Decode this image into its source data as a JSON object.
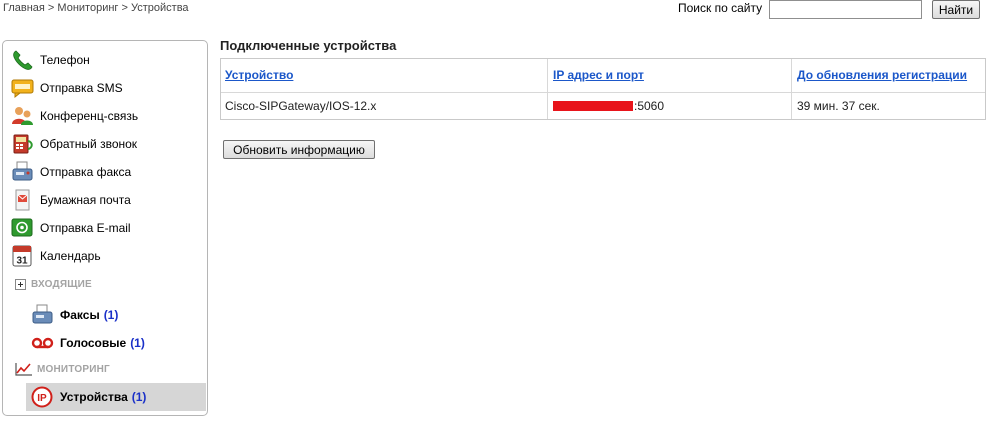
{
  "breadcrumb": {
    "home": "Главная",
    "sep1": " > ",
    "monitoring": "Мониторинг",
    "sep2": " > ",
    "current": "Устройства"
  },
  "search": {
    "label": "Поиск по сайту",
    "value": "",
    "placeholder": "",
    "button": "Найти"
  },
  "sidebar": {
    "items": [
      {
        "label": "Телефон",
        "icon": "phone-icon"
      },
      {
        "label": "Отправка SMS",
        "icon": "sms-icon"
      },
      {
        "label": "Конференц-связь",
        "icon": "conference-icon"
      },
      {
        "label": "Обратный звонок",
        "icon": "callback-icon"
      },
      {
        "label": "Отправка факса",
        "icon": "fax-icon"
      },
      {
        "label": "Бумажная почта",
        "icon": "paper-mail-icon"
      },
      {
        "label": "Отправка E-mail",
        "icon": "email-icon"
      },
      {
        "label": "Календарь",
        "icon": "calendar-icon",
        "day": "31"
      }
    ],
    "incoming": {
      "title": "ВХОДЯЩИЕ",
      "items": [
        {
          "label": "Факсы",
          "count": "(1)",
          "icon": "fax-icon"
        },
        {
          "label": "Голосовые",
          "count": "(1)",
          "icon": "voicemail-icon"
        }
      ]
    },
    "monitoring": {
      "title": "МОНИТОРИНГ",
      "items": [
        {
          "label": "Устройства",
          "count": "(1)",
          "icon": "ip-device-icon",
          "selected": true
        }
      ]
    }
  },
  "main": {
    "title": "Подключенные устройства",
    "table": {
      "headers": [
        "Устройство",
        "IP адрес и порт",
        "До обновления регистрации"
      ],
      "rows": [
        {
          "device": "Cisco-SIPGateway/IOS-12.x",
          "ip_port": ":5060",
          "expires": "39 мин. 37 сек."
        }
      ]
    },
    "refresh_button": "Обновить информацию"
  },
  "colors": {
    "link": "#1b57c9",
    "count": "#1a30c8",
    "redaction": "#e8141b",
    "selected_bg": "#d6d6d6",
    "section_title": "#a3a3a3"
  }
}
